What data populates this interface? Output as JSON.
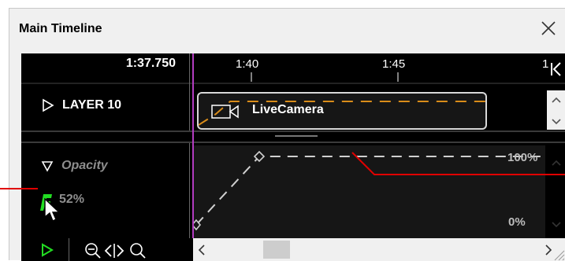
{
  "window": {
    "title": "Main Timeline",
    "close_icon": "close-icon"
  },
  "ruler": {
    "current_time": "1:37.750",
    "ticks": [
      "1:40",
      "1:45",
      "1"
    ],
    "end_icon": "skip-to-end-icon"
  },
  "layer": {
    "name": "LAYER 10",
    "expand_icon": "triangle-right-icon"
  },
  "clip": {
    "label": "LiveCamera",
    "icon": "camera-icon"
  },
  "property": {
    "name": "Opacity",
    "value": "52%",
    "keyframe_icon": "keyframe-f-icon",
    "expand_icon": "triangle-down-icon"
  },
  "curve": {
    "max_label": "100%",
    "min_label": "0%"
  },
  "toolbar": {
    "play_icon": "play-icon",
    "zoom_out_icon": "zoom-out-icon",
    "fit_icon": "fit-width-icon",
    "zoom_in_icon": "zoom-in-icon"
  },
  "colors": {
    "playhead": "#b23cc0",
    "clip_wave": "#d98c1a",
    "keyframe_green": "#22dd22",
    "callout": "#e00000"
  }
}
